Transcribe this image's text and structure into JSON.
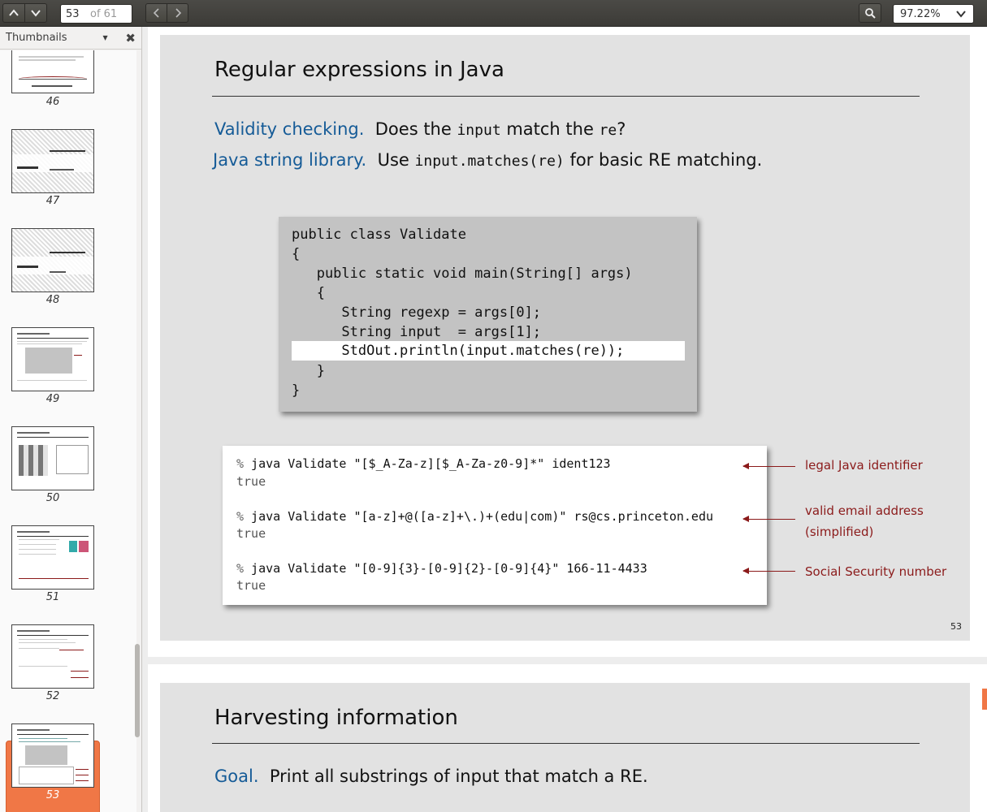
{
  "toolbar": {
    "page_current": "53",
    "page_of": "of 61",
    "zoom": "97.22%"
  },
  "sidebar": {
    "title": "Thumbnails",
    "thumbnails": [
      {
        "label": "46"
      },
      {
        "label": "47"
      },
      {
        "label": "48"
      },
      {
        "label": "49"
      },
      {
        "label": "50"
      },
      {
        "label": "51"
      },
      {
        "label": "52"
      },
      {
        "label": "53"
      }
    ],
    "selected": "53"
  },
  "slide1": {
    "title": "Regular expressions in Java",
    "line1": {
      "head": "Validity checking.",
      "t1": "Does the ",
      "c1": "input",
      "t2": " match the ",
      "c2": "re",
      "t3": "?"
    },
    "line2": {
      "head": "Java string library.",
      "t1": "Use ",
      "c1": "input.matches(re)",
      "t2": " for basic RE matching."
    },
    "code": [
      "public class Validate",
      "{",
      "   public static void main(String[] args)",
      "   {",
      "      String regexp = args[0];",
      "      String input  = args[1];",
      "      StdOut.println(input.matches(re));",
      "   }",
      "}"
    ],
    "terminal": [
      {
        "prompt": "%",
        "cmd": " java Validate \"[$_A-Za-z][$_A-Za-z0-9]*\" ident123",
        "out": "true",
        "note": [
          "legal Java identifier"
        ]
      },
      {
        "prompt": "%",
        "cmd": " java Validate \"[a-z]+@([a-z]+\\.)+(edu|com)\" rs@cs.princeton.edu",
        "out": "true",
        "note": [
          "valid email address",
          "(simplified)"
        ]
      },
      {
        "prompt": "%",
        "cmd": " java Validate \"[0-9]{3}-[0-9]{2}-[0-9]{4}\" 166-11-4433",
        "out": "true",
        "note": [
          "Social Security number"
        ]
      }
    ],
    "page_number": "53"
  },
  "slide2": {
    "title": "Harvesting information",
    "line1": {
      "head": "Goal.",
      "t1": "Print all substrings of input that match a RE."
    }
  },
  "colors": {
    "accent": "#f07746",
    "link_blue": "#155b97",
    "annotation_red": "#8b1a1a"
  }
}
